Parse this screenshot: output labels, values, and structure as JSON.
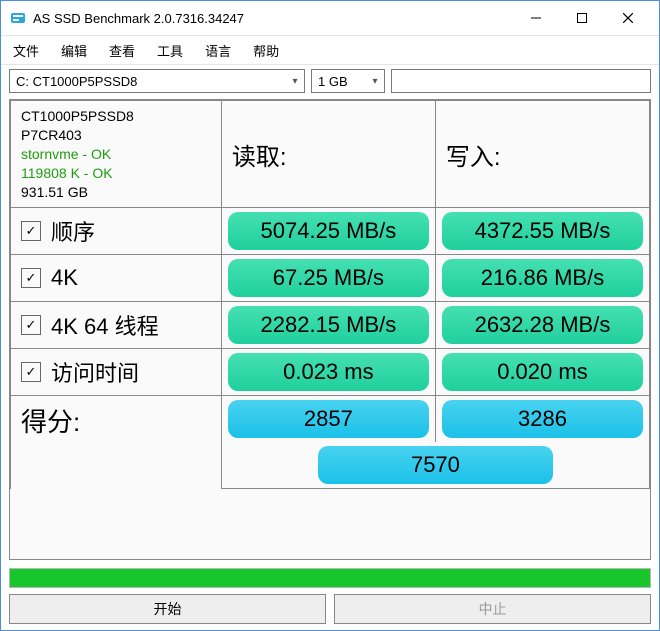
{
  "window": {
    "title": "AS SSD Benchmark 2.0.7316.34247"
  },
  "menu": {
    "file": "文件",
    "edit": "编辑",
    "view": "查看",
    "tools": "工具",
    "language": "语言",
    "help": "帮助"
  },
  "toolbar": {
    "drive": "C: CT1000P5PSSD8",
    "size": "1 GB"
  },
  "info": {
    "model": "CT1000P5PSSD8",
    "fw": "P7CR403",
    "driver": "stornvme - OK",
    "align": "119808 K - OK",
    "capacity": "931.51 GB"
  },
  "headers": {
    "read": "读取:",
    "write": "写入:"
  },
  "rows": {
    "seq": {
      "label": "顺序",
      "read": "5074.25 MB/s",
      "write": "4372.55 MB/s"
    },
    "fourk": {
      "label": "4K",
      "read": "67.25 MB/s",
      "write": "216.86 MB/s"
    },
    "fk64": {
      "label": "4K 64 线程",
      "read": "2282.15 MB/s",
      "write": "2632.28 MB/s"
    },
    "access": {
      "label": "访问时间",
      "read": "0.023 ms",
      "write": "0.020 ms"
    }
  },
  "score": {
    "label": "得分:",
    "read": "2857",
    "write": "3286",
    "total": "7570"
  },
  "buttons": {
    "start": "开始",
    "stop": "中止"
  }
}
